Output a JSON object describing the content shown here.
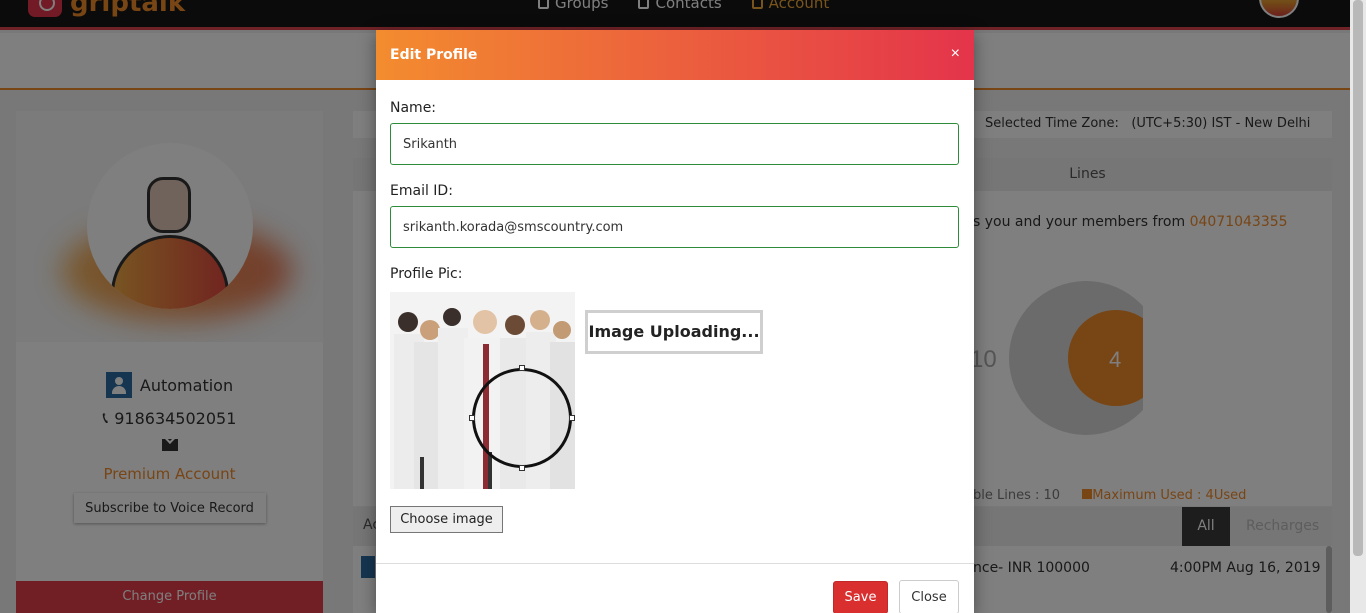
{
  "app": {
    "logo_text": "griptalk"
  },
  "nav": {
    "items": [
      {
        "label": "Groups"
      },
      {
        "label": "Contacts"
      },
      {
        "label": "Account"
      }
    ]
  },
  "profile": {
    "name": "Automation",
    "phone": "918634502051",
    "account_type": "Premium Account",
    "subscribe_label": "Subscribe to Voice Record",
    "change_profile_label": "Change Profile"
  },
  "timezone": {
    "label": "Selected Time Zone:",
    "value": "(UTC+5:30) IST - New Delhi"
  },
  "lines": {
    "header": "Lines",
    "text_prefix": "s you and your members from",
    "number": "04071043355",
    "legend_available": "ble Lines : 10",
    "legend_max": "Maximum Used : 4Used"
  },
  "chart_data": {
    "type": "pie",
    "values": [
      10,
      4
    ],
    "labels": [
      "10",
      "4"
    ],
    "colors": [
      "#d6d6d6",
      "#f08b2a"
    ]
  },
  "activity": {
    "label": "Ac",
    "tabs": [
      {
        "label": "All"
      },
      {
        "label": "Recharges"
      }
    ],
    "rows": [
      {
        "description": "nce- INR 100000",
        "time": "4:00PM Aug 16, 2019"
      }
    ]
  },
  "modal": {
    "title": "Edit Profile",
    "close_symbol": "×",
    "name_label": "Name:",
    "name_value": "Srikanth",
    "email_label": "Email ID:",
    "email_value": "srikanth.korada@smscountry.com",
    "pic_label": "Profile Pic:",
    "uploading_text": "Image Uploading...",
    "choose_image_label": "Choose image",
    "save_label": "Save",
    "close_label": "Close"
  },
  "colors": {
    "accent": "#f08b2a",
    "brand_red": "#e33e4a",
    "nav_bg": "#161616"
  }
}
